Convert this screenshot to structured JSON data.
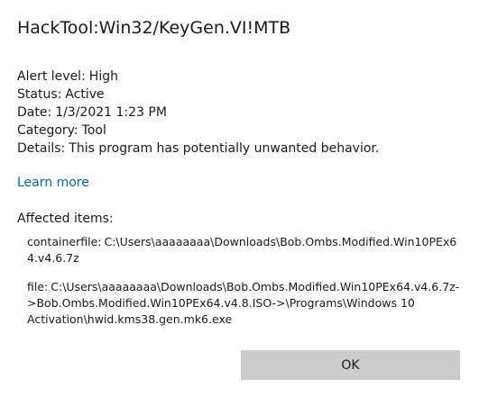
{
  "threat": {
    "name": "HackTool:Win32/KeyGen.VI!MTB"
  },
  "details": [
    {
      "label": "Alert level:",
      "value": "High"
    },
    {
      "label": "Status:",
      "value": "Active"
    },
    {
      "label": "Date:",
      "value": "1/3/2021 1:23 PM"
    },
    {
      "label": "Category:",
      "value": "Tool"
    },
    {
      "label": "Details:",
      "value": "This program has potentially unwanted behavior."
    }
  ],
  "learn_more": "Learn more",
  "affected": {
    "heading": "Affected items:",
    "items": [
      {
        "type": "containerfile:",
        "path": "C:\\Users\\aaaaaaaa\\Downloads\\Bob.Ombs.Modified.Win10PEx64.v4.6.7z"
      },
      {
        "type": "file:",
        "path": "C:\\Users\\aaaaaaaa\\Downloads\\Bob.Ombs.Modified.Win10PEx64.v4.6.7z->Bob.Ombs.Modified.Win10PEx64.v4.8.ISO->\\Programs\\Windows 10 Activation\\hwid.kms38.gen.mk6.exe"
      }
    ]
  },
  "buttons": {
    "ok": "OK"
  },
  "colors": {
    "link": "#0067b8",
    "button_bg": "#cccccc",
    "text": "#1a1a1a"
  }
}
